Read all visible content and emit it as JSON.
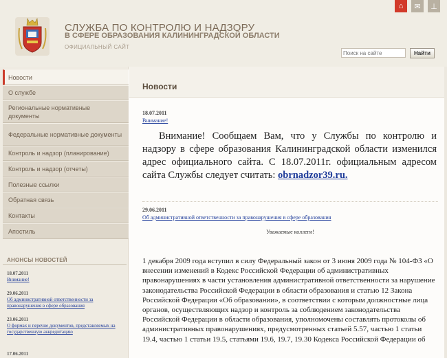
{
  "header": {
    "title_line1": "СЛУЖБА ПО КОНТРОЛЮ И НАДЗОРУ",
    "title_line2": "В СФЕРЕ ОБРАЗОВАНИЯ КАЛИНИНГРАДСКОЙ ОБЛАСТИ",
    "subtitle": "ОФИЦИАЛЬНЫЙ САЙТ",
    "search_placeholder": "Поиск на сайте",
    "search_button": "Найти",
    "top_icons": [
      "home-icon",
      "mail-icon",
      "sitemap-icon"
    ]
  },
  "sidebar": {
    "items": [
      {
        "label": "Новости"
      },
      {
        "label": "О службе"
      },
      {
        "label": "Региональные нормативные документы"
      },
      {
        "label": "Федеральные нормативные документы"
      },
      {
        "label": "Контроль и надзор (планирование)"
      },
      {
        "label": "Контроль и надзор (отчеты)"
      },
      {
        "label": "Полезные ссылки"
      },
      {
        "label": "Обратная связь"
      },
      {
        "label": "Контакты"
      },
      {
        "label": "Апостиль"
      }
    ],
    "news_heading": "АНОНСЫ НОВОСТЕЙ",
    "news": [
      {
        "date": "18.07.2011",
        "title": "Внимание!"
      },
      {
        "date": "29.06.2011",
        "title": "Об административной ответственности за правонарушения в сфере образования"
      },
      {
        "date": "23.06.2011",
        "title": "О формах и перечне документов, представляемых на государственную аккредитацию"
      },
      {
        "date": "17.06.2011",
        "title": ""
      }
    ]
  },
  "main": {
    "title": "Новости",
    "entry1": {
      "date": "18.07.2011",
      "link": "Внимание!",
      "text": "Внимание! Сообщаем Вам, что у Службы по контролю и надзору в сфере образования Калининградской области изменился адрес официального сайта. С 18.07.2011г. официальным адресом сайта Службы следует считать:",
      "url_text": "obrnadzor39.ru."
    },
    "entry2": {
      "date": "29.06.2011",
      "link": "Об административной ответственности за правонарушения в сфере образования",
      "greeting": "Уважаемые коллеги!",
      "text": "1 декабря 2009 года вступил в силу Федеральный закон от 3 июня 2009 года № 104-ФЗ «О внесении изменений в Кодекс Российской Федерации об административных правонарушениях в части установления административной ответственности за нарушение законодательства Российской Федерации в области образования и статью 12 Закона Российской Федерации «Об образовании», в соответствии с которым должностные лица органов, осуществляющих надзор и контроль за соблюдением законодательства Российской Федерации в области образования, уполномочены составлять протоколы об административных правонарушениях, предусмотренных статьей 5.57, частью 1 статьи 19.4, частью 1 статьи 19.5, статьями 19.6, 19.7, 19.30 Кодекса Российской Федерации об"
    }
  },
  "colors": {
    "accent": "#cc3c2b",
    "header_bg": "#f0ede4",
    "nav_bg": "#ddd6c9",
    "link": "#1f3c9a"
  }
}
